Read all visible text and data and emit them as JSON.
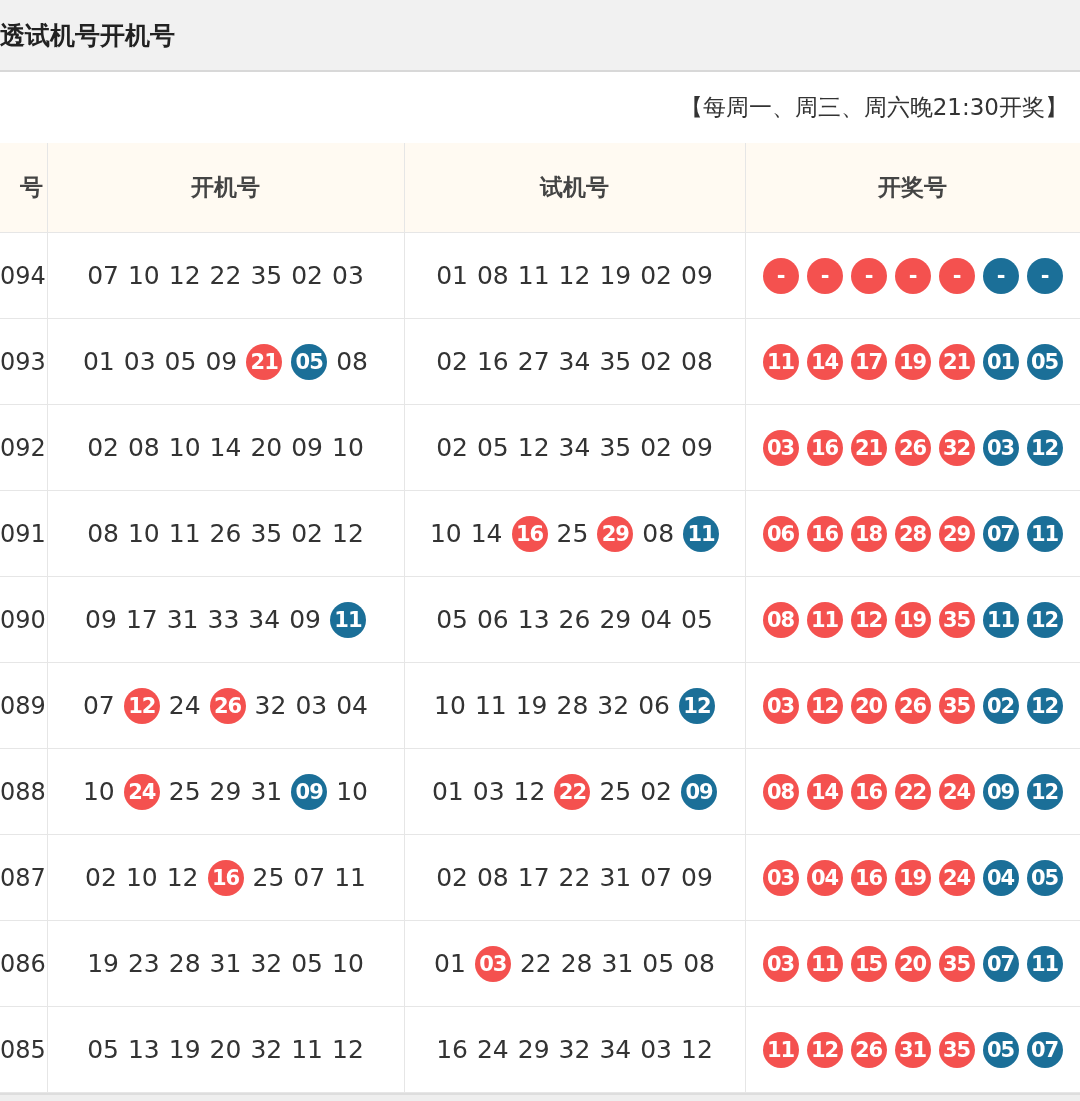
{
  "title": "透试机号开机号",
  "schedule": "【每周一、周三、周六晚21:30开奖】",
  "table": {
    "columns": [
      "号",
      "开机号",
      "试机号",
      "开奖号"
    ],
    "rows": [
      {
        "issue": "094",
        "open": [
          {
            "n": "07",
            "kind": "plain"
          },
          {
            "n": "10",
            "kind": "plain"
          },
          {
            "n": "12",
            "kind": "plain"
          },
          {
            "n": "22",
            "kind": "plain"
          },
          {
            "n": "35",
            "kind": "plain"
          },
          {
            "n": "02",
            "kind": "plain"
          },
          {
            "n": "03",
            "kind": "plain"
          }
        ],
        "trial": [
          {
            "n": "01",
            "kind": "plain"
          },
          {
            "n": "08",
            "kind": "plain"
          },
          {
            "n": "11",
            "kind": "plain"
          },
          {
            "n": "12",
            "kind": "plain"
          },
          {
            "n": "19",
            "kind": "plain"
          },
          {
            "n": "02",
            "kind": "plain"
          },
          {
            "n": "09",
            "kind": "plain"
          }
        ],
        "prize": [
          {
            "n": "-",
            "kind": "red"
          },
          {
            "n": "-",
            "kind": "red"
          },
          {
            "n": "-",
            "kind": "red"
          },
          {
            "n": "-",
            "kind": "red"
          },
          {
            "n": "-",
            "kind": "red"
          },
          {
            "n": "-",
            "kind": "blue"
          },
          {
            "n": "-",
            "kind": "blue"
          }
        ]
      },
      {
        "issue": "093",
        "open": [
          {
            "n": "01",
            "kind": "plain"
          },
          {
            "n": "03",
            "kind": "plain"
          },
          {
            "n": "05",
            "kind": "plain"
          },
          {
            "n": "09",
            "kind": "plain"
          },
          {
            "n": "21",
            "kind": "red"
          },
          {
            "n": "05",
            "kind": "blue"
          },
          {
            "n": "08",
            "kind": "plain"
          }
        ],
        "trial": [
          {
            "n": "02",
            "kind": "plain"
          },
          {
            "n": "16",
            "kind": "plain"
          },
          {
            "n": "27",
            "kind": "plain"
          },
          {
            "n": "34",
            "kind": "plain"
          },
          {
            "n": "35",
            "kind": "plain"
          },
          {
            "n": "02",
            "kind": "plain"
          },
          {
            "n": "08",
            "kind": "plain"
          }
        ],
        "prize": [
          {
            "n": "11",
            "kind": "red"
          },
          {
            "n": "14",
            "kind": "red"
          },
          {
            "n": "17",
            "kind": "red"
          },
          {
            "n": "19",
            "kind": "red"
          },
          {
            "n": "21",
            "kind": "red"
          },
          {
            "n": "01",
            "kind": "blue"
          },
          {
            "n": "05",
            "kind": "blue"
          }
        ]
      },
      {
        "issue": "092",
        "open": [
          {
            "n": "02",
            "kind": "plain"
          },
          {
            "n": "08",
            "kind": "plain"
          },
          {
            "n": "10",
            "kind": "plain"
          },
          {
            "n": "14",
            "kind": "plain"
          },
          {
            "n": "20",
            "kind": "plain"
          },
          {
            "n": "09",
            "kind": "plain"
          },
          {
            "n": "10",
            "kind": "plain"
          }
        ],
        "trial": [
          {
            "n": "02",
            "kind": "plain"
          },
          {
            "n": "05",
            "kind": "plain"
          },
          {
            "n": "12",
            "kind": "plain"
          },
          {
            "n": "34",
            "kind": "plain"
          },
          {
            "n": "35",
            "kind": "plain"
          },
          {
            "n": "02",
            "kind": "plain"
          },
          {
            "n": "09",
            "kind": "plain"
          }
        ],
        "prize": [
          {
            "n": "03",
            "kind": "red"
          },
          {
            "n": "16",
            "kind": "red"
          },
          {
            "n": "21",
            "kind": "red"
          },
          {
            "n": "26",
            "kind": "red"
          },
          {
            "n": "32",
            "kind": "red"
          },
          {
            "n": "03",
            "kind": "blue"
          },
          {
            "n": "12",
            "kind": "blue"
          }
        ]
      },
      {
        "issue": "091",
        "open": [
          {
            "n": "08",
            "kind": "plain"
          },
          {
            "n": "10",
            "kind": "plain"
          },
          {
            "n": "11",
            "kind": "plain"
          },
          {
            "n": "26",
            "kind": "plain"
          },
          {
            "n": "35",
            "kind": "plain"
          },
          {
            "n": "02",
            "kind": "plain"
          },
          {
            "n": "12",
            "kind": "plain"
          }
        ],
        "trial": [
          {
            "n": "10",
            "kind": "plain"
          },
          {
            "n": "14",
            "kind": "plain"
          },
          {
            "n": "16",
            "kind": "red"
          },
          {
            "n": "25",
            "kind": "plain"
          },
          {
            "n": "29",
            "kind": "red"
          },
          {
            "n": "08",
            "kind": "plain"
          },
          {
            "n": "11",
            "kind": "blue"
          }
        ],
        "prize": [
          {
            "n": "06",
            "kind": "red"
          },
          {
            "n": "16",
            "kind": "red"
          },
          {
            "n": "18",
            "kind": "red"
          },
          {
            "n": "28",
            "kind": "red"
          },
          {
            "n": "29",
            "kind": "red"
          },
          {
            "n": "07",
            "kind": "blue"
          },
          {
            "n": "11",
            "kind": "blue"
          }
        ]
      },
      {
        "issue": "090",
        "open": [
          {
            "n": "09",
            "kind": "plain"
          },
          {
            "n": "17",
            "kind": "plain"
          },
          {
            "n": "31",
            "kind": "plain"
          },
          {
            "n": "33",
            "kind": "plain"
          },
          {
            "n": "34",
            "kind": "plain"
          },
          {
            "n": "09",
            "kind": "plain"
          },
          {
            "n": "11",
            "kind": "blue"
          }
        ],
        "trial": [
          {
            "n": "05",
            "kind": "plain"
          },
          {
            "n": "06",
            "kind": "plain"
          },
          {
            "n": "13",
            "kind": "plain"
          },
          {
            "n": "26",
            "kind": "plain"
          },
          {
            "n": "29",
            "kind": "plain"
          },
          {
            "n": "04",
            "kind": "plain"
          },
          {
            "n": "05",
            "kind": "plain"
          }
        ],
        "prize": [
          {
            "n": "08",
            "kind": "red"
          },
          {
            "n": "11",
            "kind": "red"
          },
          {
            "n": "12",
            "kind": "red"
          },
          {
            "n": "19",
            "kind": "red"
          },
          {
            "n": "35",
            "kind": "red"
          },
          {
            "n": "11",
            "kind": "blue"
          },
          {
            "n": "12",
            "kind": "blue"
          }
        ]
      },
      {
        "issue": "089",
        "open": [
          {
            "n": "07",
            "kind": "plain"
          },
          {
            "n": "12",
            "kind": "red"
          },
          {
            "n": "24",
            "kind": "plain"
          },
          {
            "n": "26",
            "kind": "red"
          },
          {
            "n": "32",
            "kind": "plain"
          },
          {
            "n": "03",
            "kind": "plain"
          },
          {
            "n": "04",
            "kind": "plain"
          }
        ],
        "trial": [
          {
            "n": "10",
            "kind": "plain"
          },
          {
            "n": "11",
            "kind": "plain"
          },
          {
            "n": "19",
            "kind": "plain"
          },
          {
            "n": "28",
            "kind": "plain"
          },
          {
            "n": "32",
            "kind": "plain"
          },
          {
            "n": "06",
            "kind": "plain"
          },
          {
            "n": "12",
            "kind": "blue"
          }
        ],
        "prize": [
          {
            "n": "03",
            "kind": "red"
          },
          {
            "n": "12",
            "kind": "red"
          },
          {
            "n": "20",
            "kind": "red"
          },
          {
            "n": "26",
            "kind": "red"
          },
          {
            "n": "35",
            "kind": "red"
          },
          {
            "n": "02",
            "kind": "blue"
          },
          {
            "n": "12",
            "kind": "blue"
          }
        ]
      },
      {
        "issue": "088",
        "open": [
          {
            "n": "10",
            "kind": "plain"
          },
          {
            "n": "24",
            "kind": "red"
          },
          {
            "n": "25",
            "kind": "plain"
          },
          {
            "n": "29",
            "kind": "plain"
          },
          {
            "n": "31",
            "kind": "plain"
          },
          {
            "n": "09",
            "kind": "blue"
          },
          {
            "n": "10",
            "kind": "plain"
          }
        ],
        "trial": [
          {
            "n": "01",
            "kind": "plain"
          },
          {
            "n": "03",
            "kind": "plain"
          },
          {
            "n": "12",
            "kind": "plain"
          },
          {
            "n": "22",
            "kind": "red"
          },
          {
            "n": "25",
            "kind": "plain"
          },
          {
            "n": "02",
            "kind": "plain"
          },
          {
            "n": "09",
            "kind": "blue"
          }
        ],
        "prize": [
          {
            "n": "08",
            "kind": "red"
          },
          {
            "n": "14",
            "kind": "red"
          },
          {
            "n": "16",
            "kind": "red"
          },
          {
            "n": "22",
            "kind": "red"
          },
          {
            "n": "24",
            "kind": "red"
          },
          {
            "n": "09",
            "kind": "blue"
          },
          {
            "n": "12",
            "kind": "blue"
          }
        ]
      },
      {
        "issue": "087",
        "open": [
          {
            "n": "02",
            "kind": "plain"
          },
          {
            "n": "10",
            "kind": "plain"
          },
          {
            "n": "12",
            "kind": "plain"
          },
          {
            "n": "16",
            "kind": "red"
          },
          {
            "n": "25",
            "kind": "plain"
          },
          {
            "n": "07",
            "kind": "plain"
          },
          {
            "n": "11",
            "kind": "plain"
          }
        ],
        "trial": [
          {
            "n": "02",
            "kind": "plain"
          },
          {
            "n": "08",
            "kind": "plain"
          },
          {
            "n": "17",
            "kind": "plain"
          },
          {
            "n": "22",
            "kind": "plain"
          },
          {
            "n": "31",
            "kind": "plain"
          },
          {
            "n": "07",
            "kind": "plain"
          },
          {
            "n": "09",
            "kind": "plain"
          }
        ],
        "prize": [
          {
            "n": "03",
            "kind": "red"
          },
          {
            "n": "04",
            "kind": "red"
          },
          {
            "n": "16",
            "kind": "red"
          },
          {
            "n": "19",
            "kind": "red"
          },
          {
            "n": "24",
            "kind": "red"
          },
          {
            "n": "04",
            "kind": "blue"
          },
          {
            "n": "05",
            "kind": "blue"
          }
        ]
      },
      {
        "issue": "086",
        "open": [
          {
            "n": "19",
            "kind": "plain"
          },
          {
            "n": "23",
            "kind": "plain"
          },
          {
            "n": "28",
            "kind": "plain"
          },
          {
            "n": "31",
            "kind": "plain"
          },
          {
            "n": "32",
            "kind": "plain"
          },
          {
            "n": "05",
            "kind": "plain"
          },
          {
            "n": "10",
            "kind": "plain"
          }
        ],
        "trial": [
          {
            "n": "01",
            "kind": "plain"
          },
          {
            "n": "03",
            "kind": "red"
          },
          {
            "n": "22",
            "kind": "plain"
          },
          {
            "n": "28",
            "kind": "plain"
          },
          {
            "n": "31",
            "kind": "plain"
          },
          {
            "n": "05",
            "kind": "plain"
          },
          {
            "n": "08",
            "kind": "plain"
          }
        ],
        "prize": [
          {
            "n": "03",
            "kind": "red"
          },
          {
            "n": "11",
            "kind": "red"
          },
          {
            "n": "15",
            "kind": "red"
          },
          {
            "n": "20",
            "kind": "red"
          },
          {
            "n": "35",
            "kind": "red"
          },
          {
            "n": "07",
            "kind": "blue"
          },
          {
            "n": "11",
            "kind": "blue"
          }
        ]
      },
      {
        "issue": "085",
        "open": [
          {
            "n": "05",
            "kind": "plain"
          },
          {
            "n": "13",
            "kind": "plain"
          },
          {
            "n": "19",
            "kind": "plain"
          },
          {
            "n": "20",
            "kind": "plain"
          },
          {
            "n": "32",
            "kind": "plain"
          },
          {
            "n": "11",
            "kind": "plain"
          },
          {
            "n": "12",
            "kind": "plain"
          }
        ],
        "trial": [
          {
            "n": "16",
            "kind": "plain"
          },
          {
            "n": "24",
            "kind": "plain"
          },
          {
            "n": "29",
            "kind": "plain"
          },
          {
            "n": "32",
            "kind": "plain"
          },
          {
            "n": "34",
            "kind": "plain"
          },
          {
            "n": "03",
            "kind": "plain"
          },
          {
            "n": "12",
            "kind": "plain"
          }
        ],
        "prize": [
          {
            "n": "11",
            "kind": "red"
          },
          {
            "n": "12",
            "kind": "red"
          },
          {
            "n": "26",
            "kind": "red"
          },
          {
            "n": "31",
            "kind": "red"
          },
          {
            "n": "35",
            "kind": "red"
          },
          {
            "n": "05",
            "kind": "blue"
          },
          {
            "n": "07",
            "kind": "blue"
          }
        ]
      }
    ]
  }
}
